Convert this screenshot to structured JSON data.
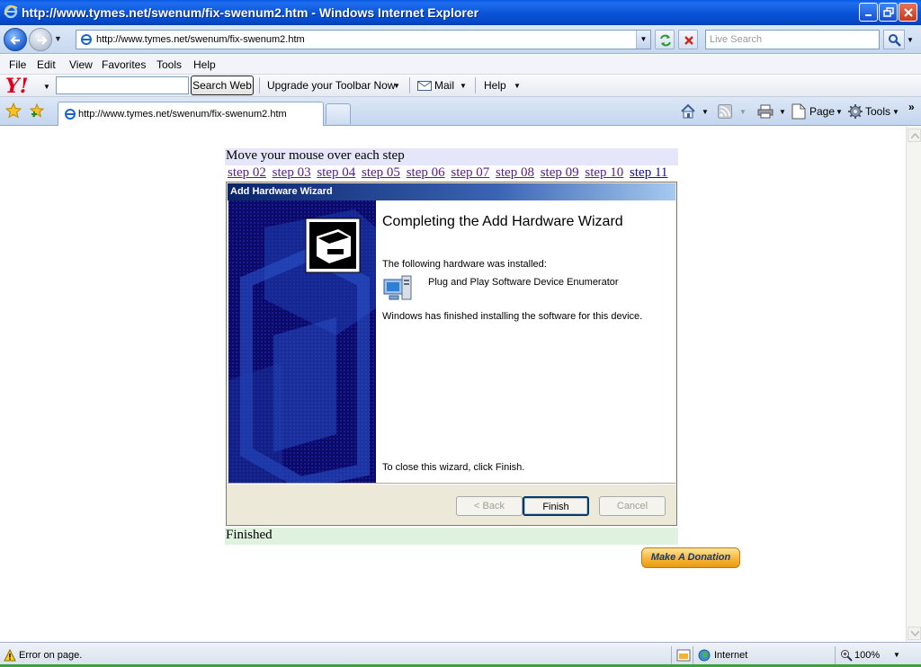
{
  "window": {
    "title": "http://www.tymes.net/swenum/fix-swenum2.htm - Windows Internet Explorer"
  },
  "addressbar": {
    "url": "http://www.tymes.net/swenum/fix-swenum2.htm",
    "search_placeholder": "Live Search"
  },
  "menu": {
    "items": [
      "File",
      "Edit",
      "View",
      "Favorites",
      "Tools",
      "Help"
    ]
  },
  "yahoo_toolbar": {
    "logo": "Y!",
    "search_button": "Search Web",
    "upgrade": "Upgrade your Toolbar Now",
    "mail": "Mail",
    "help": "Help"
  },
  "tabs": {
    "active_label": "http://www.tymes.net/swenum/fix-swenum2.htm",
    "page_label": "Page",
    "tools_label": "Tools"
  },
  "page": {
    "instruction": "Move your mouse over each step",
    "steps": [
      "step 02",
      "step 03",
      "step 04",
      "step 05",
      "step 06",
      "step 07",
      "step 08",
      "step 09",
      "step 10",
      "step 11"
    ],
    "caption": "Finished",
    "donate_label": "Make A Donation"
  },
  "wizard": {
    "title": "Add Hardware Wizard",
    "heading": "Completing the Add Hardware Wizard",
    "installed_text": "The following hardware was installed:",
    "device_name": "Plug and Play Software Device Enumerator",
    "finished_text": "Windows has finished installing the software for this device.",
    "close_text": "To close this wizard, click Finish.",
    "back_label": "< Back",
    "finish_label": "Finish",
    "cancel_label": "Cancel"
  },
  "statusbar": {
    "status": "Error on page.",
    "zone": "Internet",
    "zoom": "100%"
  },
  "colors": {
    "titlebar": "#0b55d9",
    "wizard_side": "#0a0a6a",
    "step_link": "#5a1a8a",
    "finished_bg": "#dff2df",
    "instruction_bg": "#e6e6fa"
  }
}
